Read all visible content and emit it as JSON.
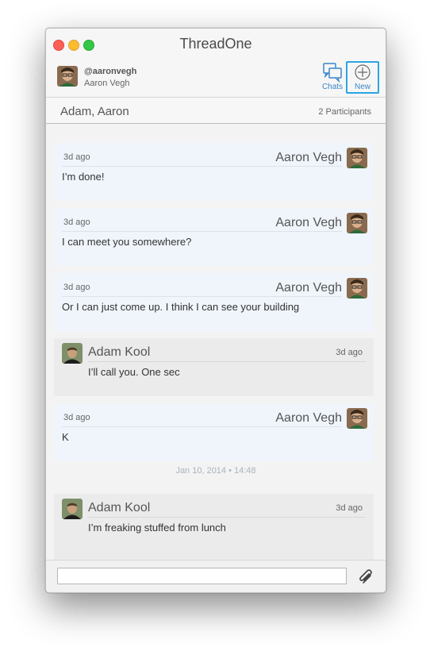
{
  "window": {
    "title": "ThreadOne"
  },
  "account": {
    "handle": "@aaronvegh",
    "name": "Aaron Vegh"
  },
  "toolbar": {
    "chats_label": "Chats",
    "new_label": "New"
  },
  "thread": {
    "title": "Adam, Aaron",
    "participants": "2 Participants"
  },
  "messages": [
    {
      "sender": "Aaron Vegh",
      "time": "3d ago",
      "text": "I’m done!"
    },
    {
      "sender": "Aaron Vegh",
      "time": "3d ago",
      "text": "I can meet you somewhere?"
    },
    {
      "sender": "Aaron Vegh",
      "time": "3d ago",
      "text": "Or I can just come up. I think I can see your building"
    },
    {
      "sender": "Adam Kool",
      "time": "3d ago",
      "text": "I’ll call you. One sec"
    },
    {
      "sender": "Aaron Vegh",
      "time": "3d ago",
      "text": "K"
    },
    {
      "sender": "Adam Kool",
      "time": "3d ago",
      "text": "I’m freaking stuffed from lunch"
    }
  ],
  "date_separator": "Jan 10, 2014 • 14:48",
  "composer": {
    "value": ""
  },
  "colors": {
    "accent": "#2aa6e0",
    "own_bubble": "#eff5fb",
    "other_bubble": "#ebebeb"
  }
}
